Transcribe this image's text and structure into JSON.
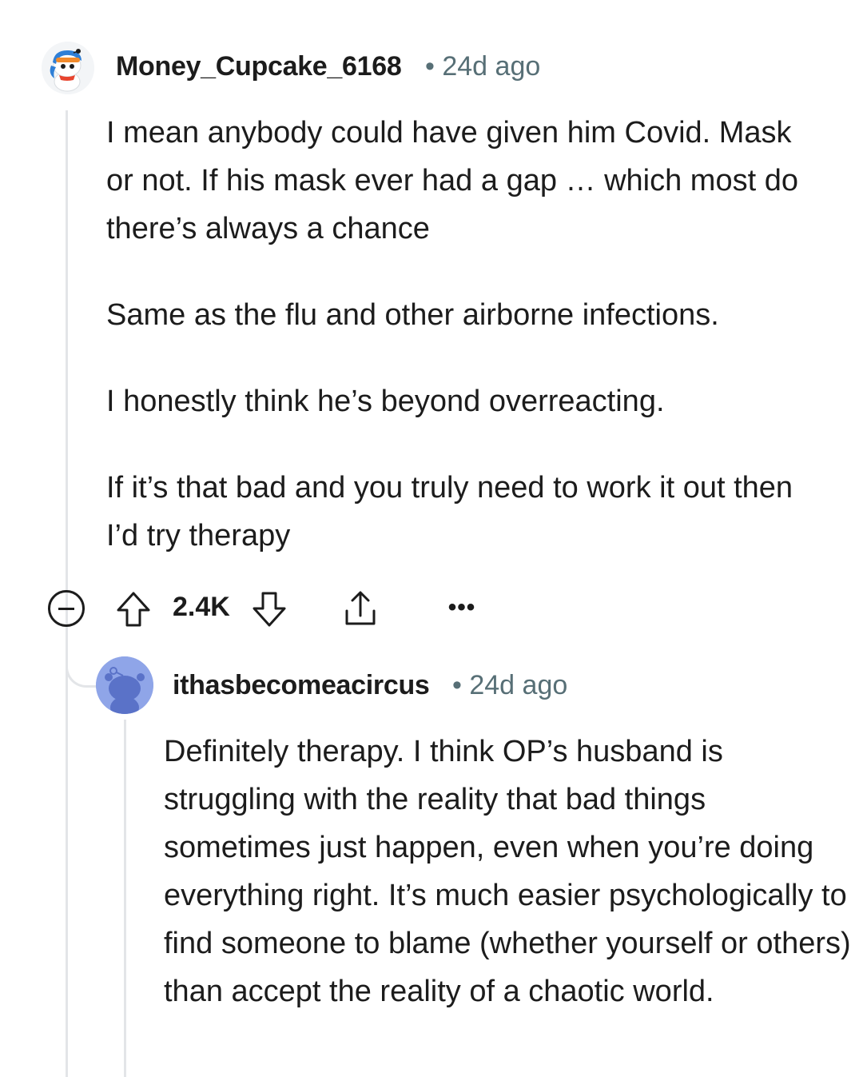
{
  "comment": {
    "username": "Money_Cupcake_6168",
    "separator": "•",
    "time": "24d ago",
    "body": [
      "I mean anybody could have given him Covid. Mask or not. If his mask ever had a gap … which most do there’s always a chance",
      "Same as the flu and other airborne infections.",
      "I honestly think he’s beyond overreacting.",
      "If it’s that bad and you truly need to work it out then I’d try therapy"
    ],
    "actions": {
      "collapse_icon": "minus-circle-icon",
      "upvote_icon": "arrow-up-icon",
      "score": "2.4K",
      "downvote_icon": "arrow-down-icon",
      "share_icon": "share-icon",
      "more_label": "•••"
    }
  },
  "reply": {
    "username": "ithasbecomeacircus",
    "separator": "•",
    "time": "24d ago",
    "body": "Definitely therapy. I think OP’s husband is struggling with the reality that bad things sometimes just happen, even when you’re doing everything right. It’s much easier psychologically to find someone to blame (whether yourself or others) than accept the reality of a chaotic world."
  },
  "colors": {
    "text": "#1c1c1c",
    "meta": "#576f76",
    "thread_line": "#e3e5e8",
    "reply_avatar_bg": "#8fa5e8"
  }
}
